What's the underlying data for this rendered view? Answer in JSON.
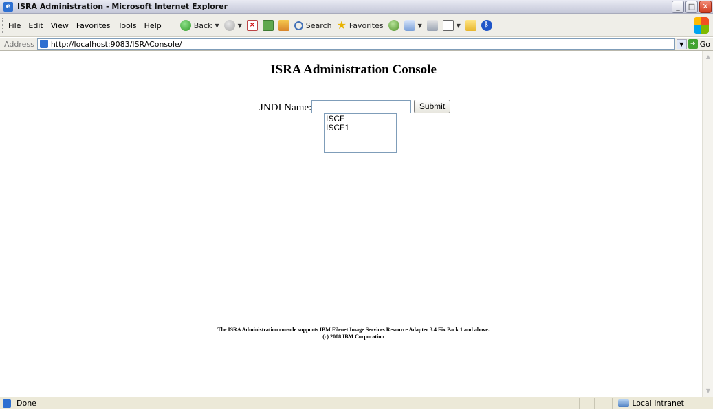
{
  "window": {
    "title": "ISRA Administration - Microsoft Internet Explorer"
  },
  "menu": [
    "File",
    "Edit",
    "View",
    "Favorites",
    "Tools",
    "Help"
  ],
  "toolbar": {
    "back": "Back",
    "search": "Search",
    "favorites": "Favorites"
  },
  "address": {
    "label": "Address",
    "url": "http://localhost:9083/ISRAConsole/",
    "go": "Go"
  },
  "page": {
    "title": "ISRA Administration Console",
    "jndi_label": "JNDI Name:",
    "jndi_value": "",
    "submit": "Submit",
    "options": [
      "ISCF",
      "ISCF1"
    ],
    "footer_line1": "The ISRA Administration console supports IBM Filenet Image Services Resource Adapter 3.4 Fix Pack 1 and above.",
    "footer_line2": "(c) 2008 IBM Corporation"
  },
  "status": {
    "text": "Done",
    "zone": "Local intranet"
  }
}
